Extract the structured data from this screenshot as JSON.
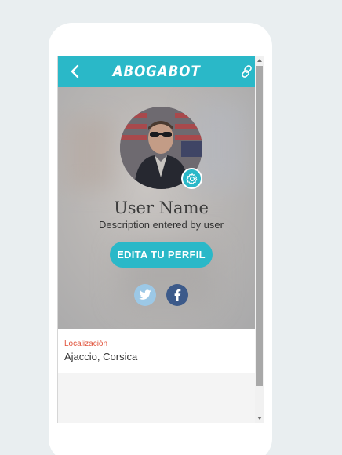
{
  "app": {
    "title": "ABOGABOT",
    "accent_color": "#2ab8c8"
  },
  "header": {
    "back_icon": "chevron-left-icon",
    "link_icon": "link-icon"
  },
  "profile": {
    "name": "User Name",
    "description": "Description entered by user",
    "edit_button_label": "EDITA TU PERFIL",
    "settings_icon": "gear-icon",
    "social": [
      {
        "name": "twitter",
        "icon": "twitter-icon",
        "color": "#9cc8e6"
      },
      {
        "name": "facebook",
        "icon": "facebook-icon",
        "color": "#3c5a8a"
      }
    ]
  },
  "info": {
    "location_label": "Localización",
    "location_value": "Ajaccio, Corsica",
    "label_color": "#e0523a"
  }
}
